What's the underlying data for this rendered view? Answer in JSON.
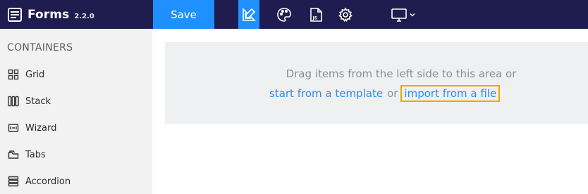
{
  "app": {
    "name": "Forms",
    "version": "2.2.0"
  },
  "toolbar": {
    "save_label": "Save"
  },
  "sidebar": {
    "title": "CONTAINERS",
    "items": [
      {
        "label": "Grid",
        "icon": "grid-icon"
      },
      {
        "label": "Stack",
        "icon": "stack-icon"
      },
      {
        "label": "Wizard",
        "icon": "wizard-icon"
      },
      {
        "label": "Tabs",
        "icon": "tabs-icon"
      },
      {
        "label": "Accordion",
        "icon": "accordion-icon"
      }
    ]
  },
  "dropzone": {
    "line1": "Drag items from the left side to this area or",
    "template_link": "start from a template",
    "or_text": "or",
    "import_link": "import from a file"
  },
  "colors": {
    "topbar": "#1f1c4f",
    "accent": "#1e90ff",
    "highlight_border": "#f4a300",
    "sidebar_bg": "#f2f2f2",
    "dropzone_bg": "#eff0f2"
  }
}
